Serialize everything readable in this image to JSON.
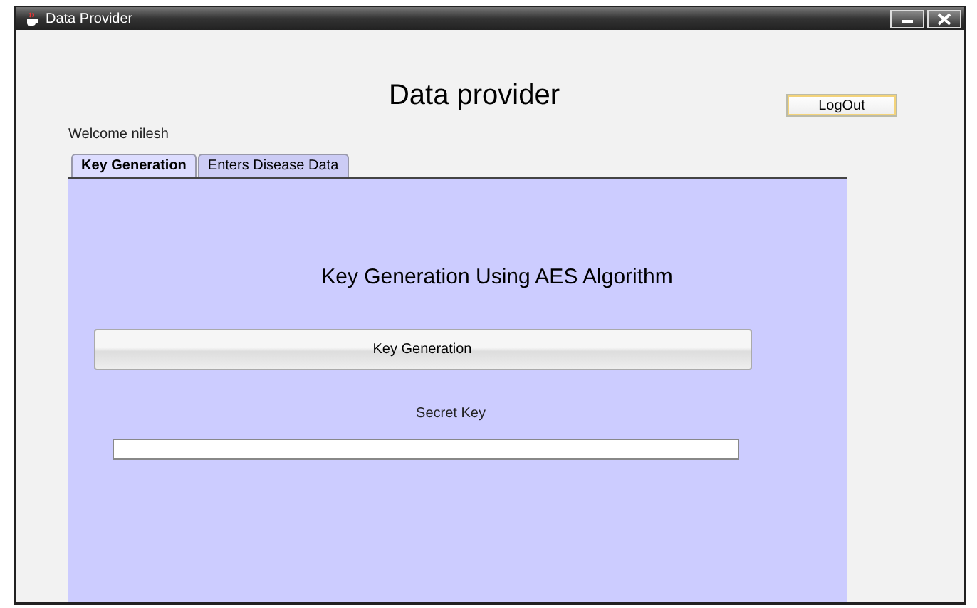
{
  "window": {
    "title": "Data Provider"
  },
  "heading": "Data provider",
  "logout_button": "LogOut",
  "welcome": "Welcome nilesh",
  "tabs": [
    {
      "label": "Key Generation",
      "selected": true
    },
    {
      "label": "Enters Disease Data",
      "selected": false
    }
  ],
  "panel": {
    "title": "Key Generation Using AES Algorithm",
    "button": "Key Generation",
    "field_label": "Secret Key"
  }
}
